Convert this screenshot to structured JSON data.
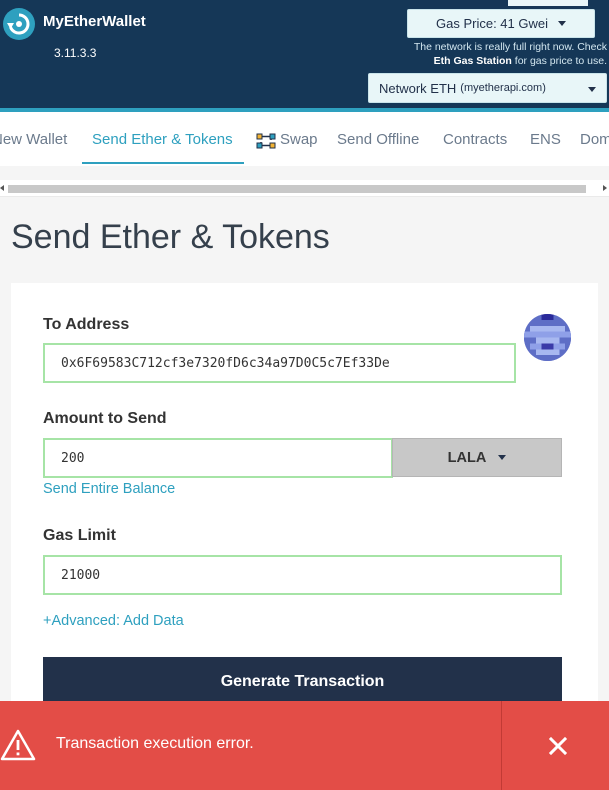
{
  "app": {
    "name": "MyEtherWallet",
    "version": "3.11.3.3"
  },
  "header": {
    "gas_price_label": "Gas Price: 41 Gwei",
    "network_msg_line1": "The network is really full right now. Check",
    "network_msg_link": "Eth Gas Station",
    "network_msg_line2": " for gas price to use.",
    "network_label": "Network ETH",
    "network_sub": "(myetherapi.com)"
  },
  "nav": {
    "items": [
      "New Wallet",
      "Send Ether & Tokens",
      "Swap",
      "Send Offline",
      "Contracts",
      "ENS",
      "Domain"
    ],
    "active": "Send Ether & Tokens"
  },
  "page": {
    "title": "Send Ether & Tokens"
  },
  "form": {
    "to_address_label": "To Address",
    "to_address_value": "0x6F69583C712cf3e7320fD6c34a97D0C5c7Ef33De",
    "amount_label": "Amount to Send",
    "amount_value": "200",
    "token_symbol": "LALA",
    "send_entire_balance": "Send Entire Balance",
    "gas_limit_label": "Gas Limit",
    "gas_limit_value": "21000",
    "advanced_link": "+Advanced: Add Data",
    "generate_button": "Generate Transaction"
  },
  "alert": {
    "message": "Transaction execution error."
  },
  "colors": {
    "header_bg": "#153757",
    "accent": "#2ea0bf",
    "button_dark": "#22314a",
    "input_border_valid": "#a6e4a6",
    "alert_bg": "#e34d47"
  },
  "icons": [
    "logo-icon",
    "caret-down-icon",
    "swap-icon",
    "identicon-avatar",
    "warning-icon",
    "close-icon"
  ]
}
